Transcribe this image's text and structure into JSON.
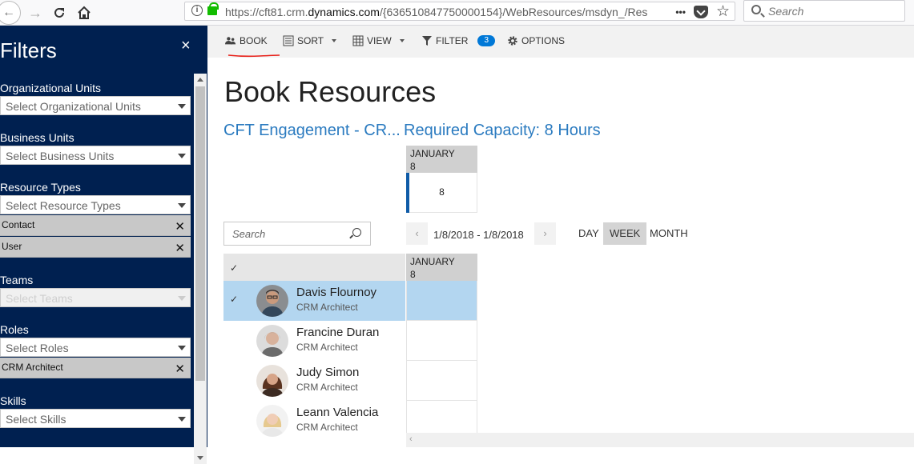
{
  "browser": {
    "url_prefix": "https://cft81.crm.",
    "url_domain": "dynamics.com",
    "url_suffix": "/{636510847750000154}/WebResources/msdyn_/Res",
    "search_placeholder": "Search",
    "more_label": "•••"
  },
  "filters": {
    "title": "Filters",
    "close_label": "×",
    "org_units": {
      "label": "Organizational Units",
      "placeholder": "Select Organizational Units"
    },
    "business_units": {
      "label": "Business Units",
      "placeholder": "Select Business Units"
    },
    "resource_types": {
      "label": "Resource Types",
      "placeholder": "Select Resource Types",
      "chips": [
        "Contact",
        "User"
      ]
    },
    "teams": {
      "label": "Teams",
      "placeholder": "Select Teams"
    },
    "roles": {
      "label": "Roles",
      "placeholder": "Select Roles",
      "chips": [
        "CRM Architect"
      ]
    },
    "skills": {
      "label": "Skills",
      "placeholder": "Select Skills"
    },
    "chip_remove": "✕"
  },
  "toolbar": {
    "book": "BOOK",
    "sort": "SORT",
    "view": "VIEW",
    "filter": "FILTER",
    "filter_count": "3",
    "options": "OPTIONS",
    "annotation_color": "#e8221b"
  },
  "main": {
    "title": "Book Resources",
    "requirement_name": "CFT Engagement - CR...",
    "required_capacity": "Required Capacity: 8 Hours",
    "req_header_month": "JANUARY",
    "req_header_day": "8",
    "req_value": "8",
    "search_placeholder": "Search",
    "prev_label": "‹",
    "next_label": "›",
    "date_range": "1/8/2018 - 1/8/2018",
    "views": [
      "DAY",
      "WEEK",
      "MONTH"
    ],
    "active_view": "WEEK",
    "grid_header_month": "JANUARY",
    "grid_header_day": "8",
    "check_mark": "✓",
    "resources": [
      {
        "name": "Davis Flournoy",
        "role": "CRM Architect",
        "selected": true
      },
      {
        "name": "Francine Duran",
        "role": "CRM Architect",
        "selected": false
      },
      {
        "name": "Judy Simon",
        "role": "CRM Architect",
        "selected": false
      },
      {
        "name": "Leann Valencia",
        "role": "CRM Architect",
        "selected": false
      }
    ]
  },
  "colors": {
    "filters_bg": "#002050",
    "accent_blue": "#2b7bc0",
    "selected_row": "#b3d6f0",
    "badge": "#0078d7"
  }
}
